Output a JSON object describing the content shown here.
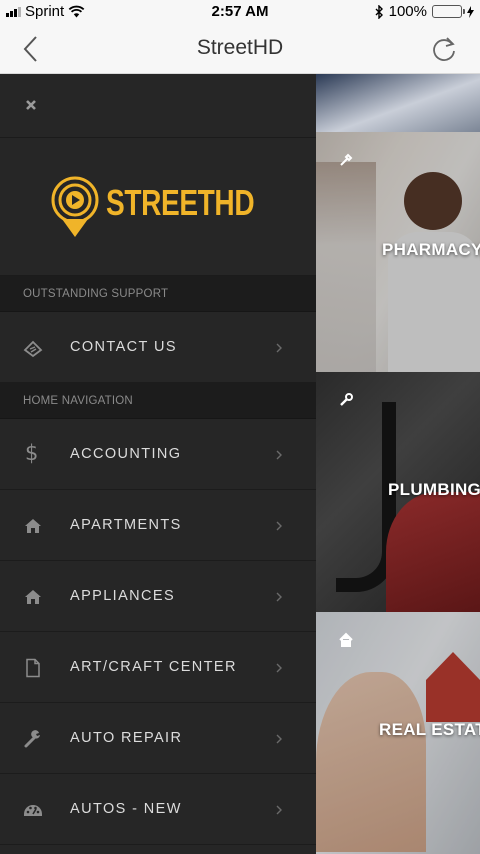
{
  "status_bar": {
    "carrier": "Sprint",
    "time": "2:57 AM",
    "battery": "100%",
    "icons": [
      "signal-icon",
      "wifi-icon",
      "bluetooth-icon",
      "battery-icon",
      "charging-icon"
    ]
  },
  "nav_bar": {
    "title": "StreetHD",
    "icons": {
      "back": "chevron-left-icon",
      "refresh": "refresh-icon"
    }
  },
  "drawer": {
    "logo_text": "STREETHD",
    "accent_color": "#f0b429",
    "sections": [
      {
        "header": "OUTSTANDING SUPPORT",
        "items": [
          {
            "label": "CONTACT US",
            "icon": "ticket-icon"
          }
        ]
      },
      {
        "header": "HOME NAVIGATION",
        "items": [
          {
            "label": "ACCOUNTING",
            "icon": "dollar-icon"
          },
          {
            "label": "APARTMENTS",
            "icon": "home-icon"
          },
          {
            "label": "APPLIANCES",
            "icon": "home-icon"
          },
          {
            "label": "ART/CRAFT CENTER",
            "icon": "file-icon"
          },
          {
            "label": "AUTO REPAIR",
            "icon": "wrench-icon"
          },
          {
            "label": "AUTOS - NEW",
            "icon": "dashboard-icon"
          }
        ]
      }
    ]
  },
  "content_tiles": [
    {
      "label": "PHARMACY",
      "icon": "eyedropper-icon"
    },
    {
      "label": "PLUMBING",
      "icon": "wrench-icon"
    },
    {
      "label": "REAL ESTATE",
      "icon": "home-icon"
    }
  ]
}
